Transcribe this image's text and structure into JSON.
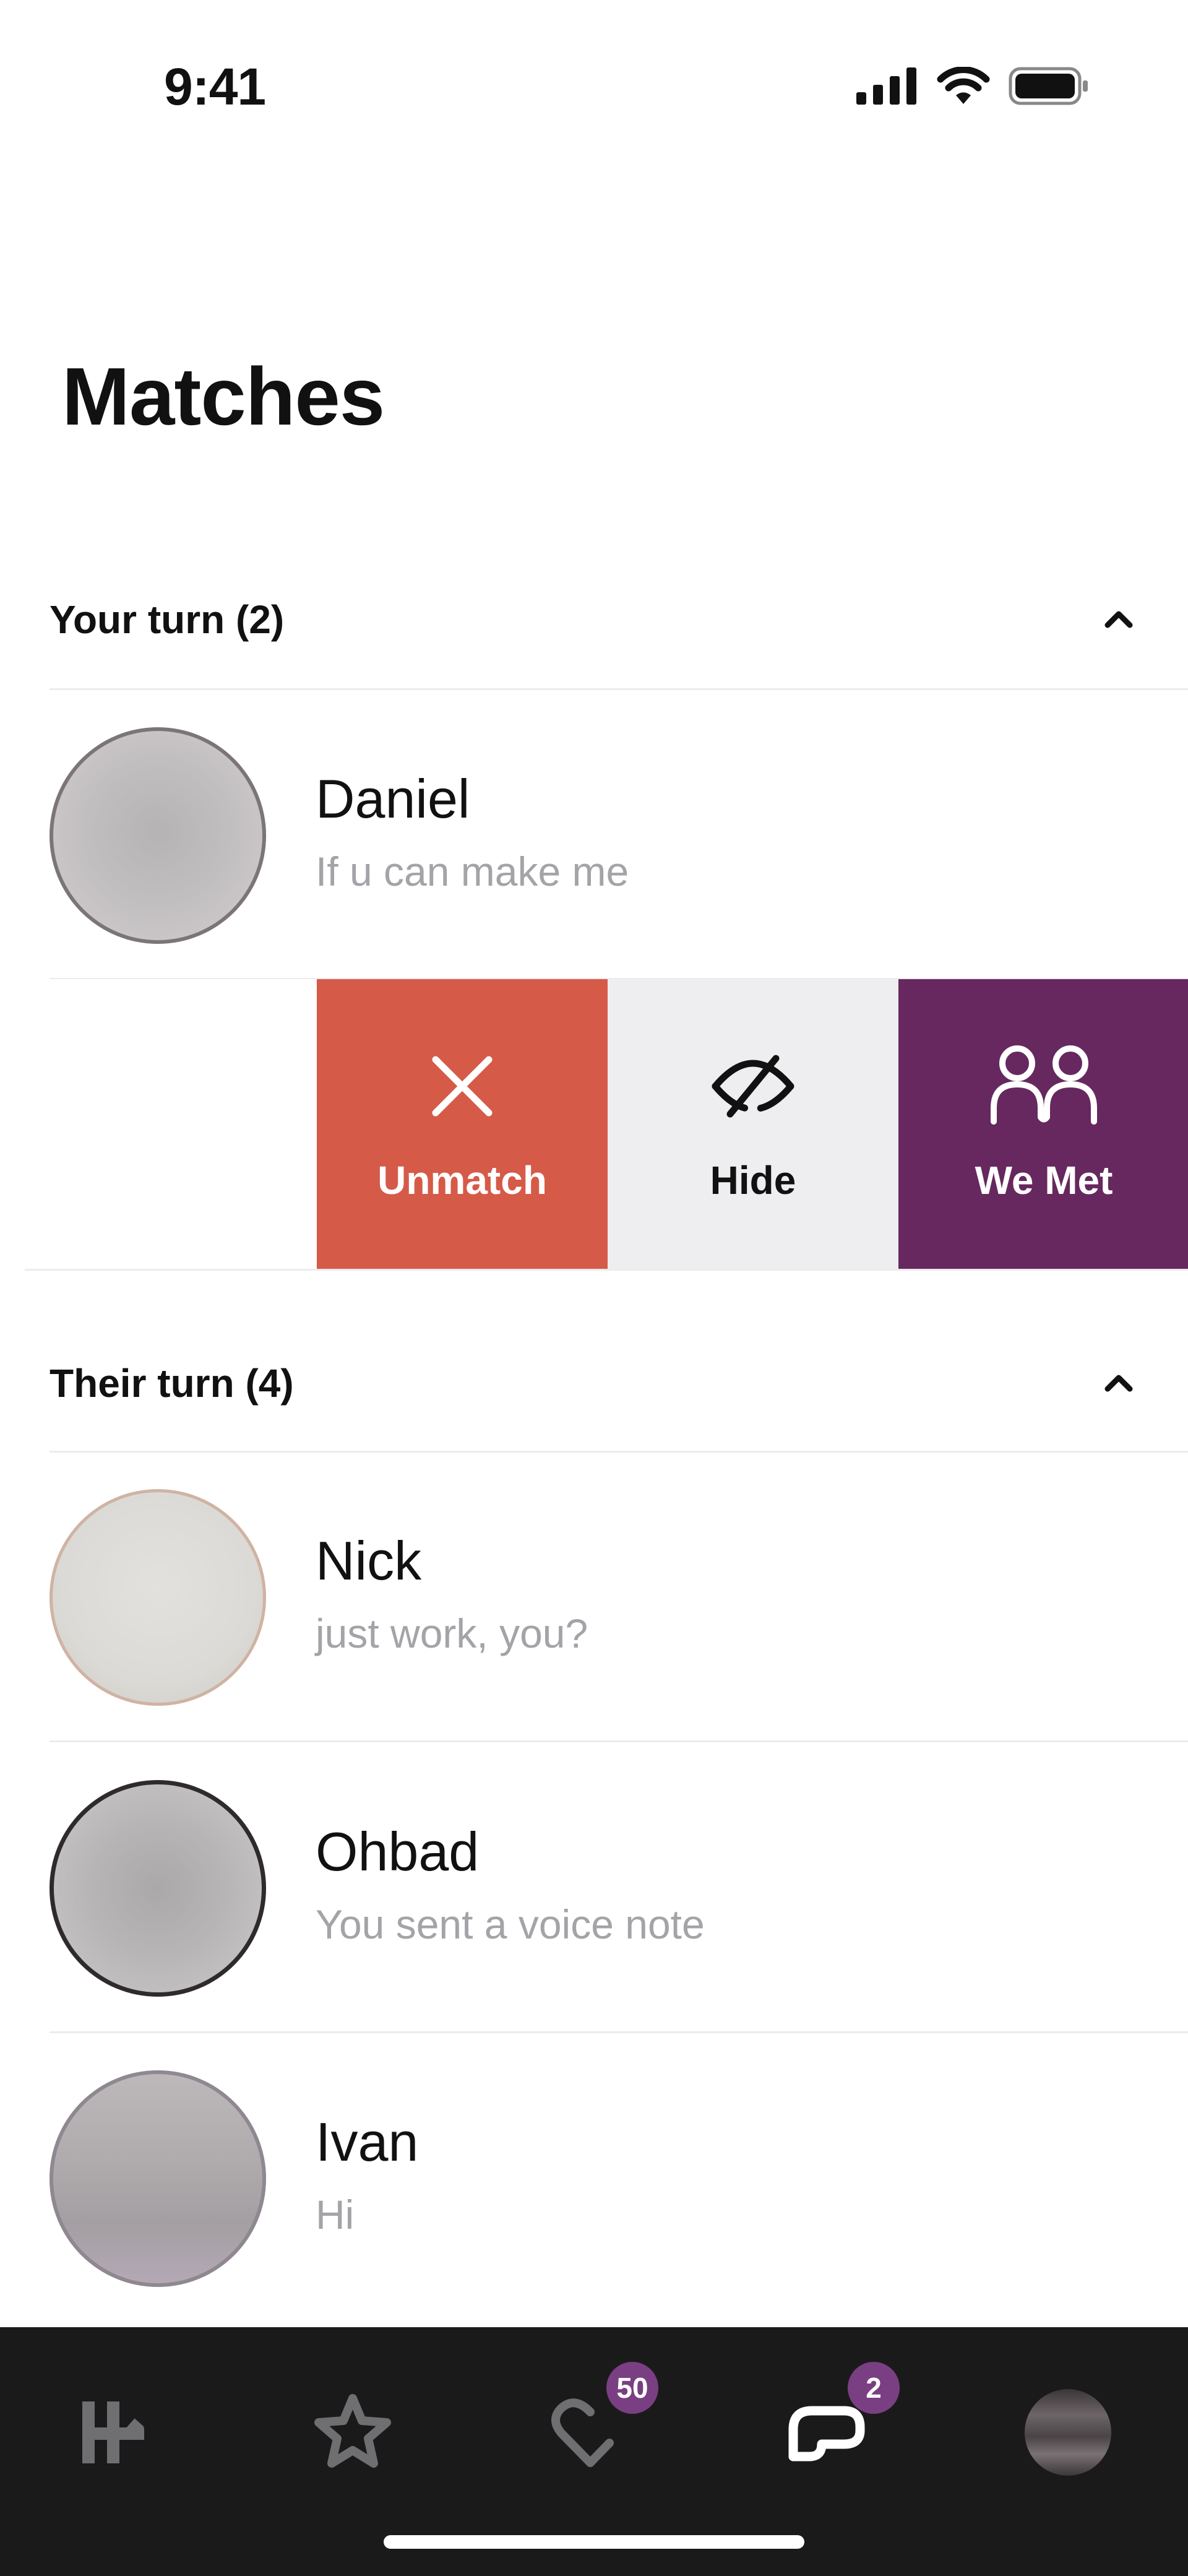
{
  "status_bar": {
    "time": "9:41"
  },
  "page_title": "Matches",
  "sections": [
    {
      "title": "Your turn (2)",
      "matches": [
        {
          "name": "Daniel",
          "preview": "If u can make me"
        }
      ]
    },
    {
      "title": "Their turn (4)",
      "matches": [
        {
          "name": "Nick",
          "preview": "just work, you?"
        },
        {
          "name": "Ohbad",
          "preview": "You sent a voice note"
        },
        {
          "name": "Ivan",
          "preview": "Hi"
        }
      ]
    }
  ],
  "swipe_actions": {
    "unmatch": {
      "label": "Unmatch",
      "color": "#d65a48"
    },
    "hide": {
      "label": "Hide",
      "color": "#eeeef0"
    },
    "we_met": {
      "label": "We Met",
      "color": "#66285e"
    }
  },
  "tab_bar": {
    "background": "#1b1a1b",
    "badge_color": "#7a3f82",
    "tabs": [
      {
        "icon": "hinge-logo-icon",
        "badge": ""
      },
      {
        "icon": "star-icon",
        "badge": ""
      },
      {
        "icon": "likes-heart-icon",
        "badge": "50"
      },
      {
        "icon": "chat-bubble-icon",
        "badge": "2",
        "active": true
      },
      {
        "icon": "profile-avatar",
        "badge": ""
      }
    ]
  }
}
